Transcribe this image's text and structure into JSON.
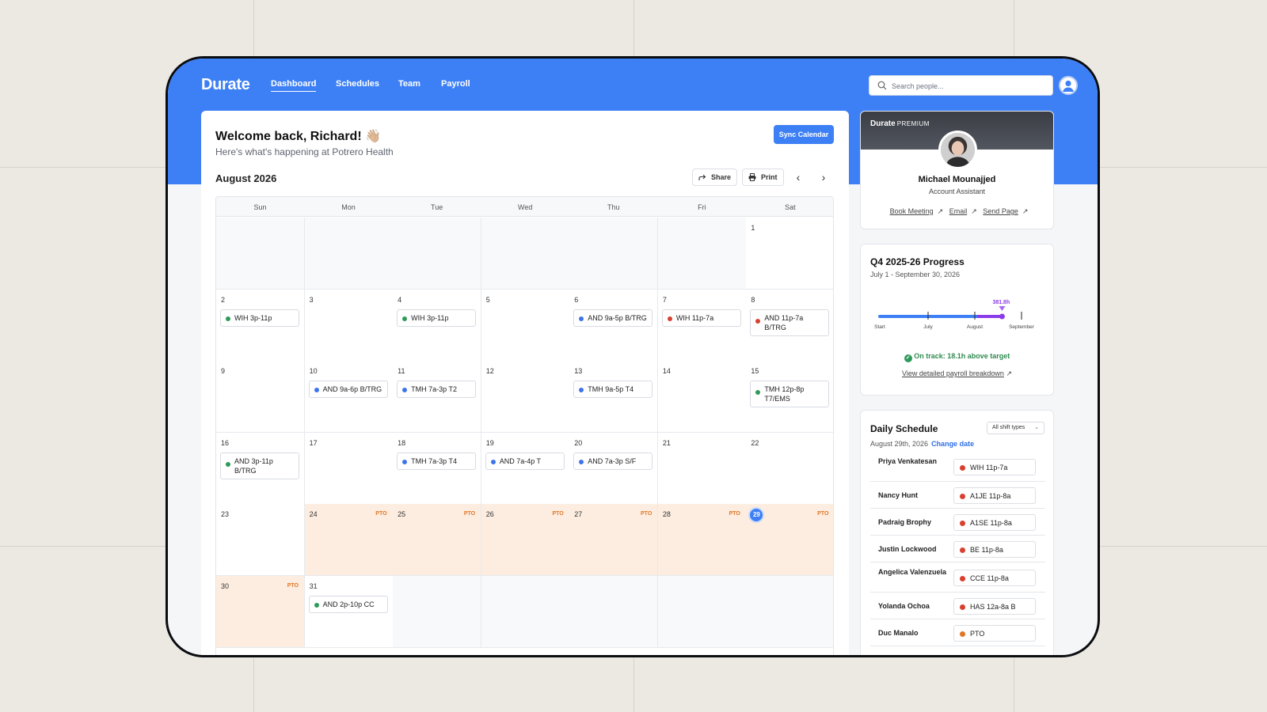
{
  "colors": {
    "accent": "#3d80f5",
    "green": "#2e9a5a",
    "blue": "#3d74ea",
    "red": "#d8402f",
    "orange": "#e07626",
    "pto_bg": "#fcede0",
    "purple": "#8a3ce8"
  },
  "app": {
    "logo": "Durate"
  },
  "nav": {
    "items": [
      {
        "label": "Dashboard",
        "active": true
      },
      {
        "label": "Schedules",
        "active": false
      },
      {
        "label": "Team",
        "active": false
      },
      {
        "label": "Payroll",
        "active": false
      }
    ]
  },
  "search": {
    "placeholder": "Search people...",
    "icon": "search-icon"
  },
  "header": {
    "welcome": "Welcome back, Richard! 👋🏼",
    "subtitle": "Here's what's happening at Potrero Health",
    "sync_label": "Sync Calendar"
  },
  "calendar": {
    "month": "August 2026",
    "share_label": "Share",
    "print_label": "Print",
    "days_of_week": [
      "Sun",
      "Mon",
      "Tue",
      "Wed",
      "Thu",
      "Fri",
      "Sat"
    ],
    "pto_label": "PTO",
    "today": 29,
    "first_weekday": 6,
    "days_in_month": 31,
    "pto_days": [
      24,
      25,
      26,
      27,
      28,
      29,
      30
    ],
    "shifts": {
      "2": {
        "text": "WIH 3p-11p",
        "color": "green"
      },
      "4": {
        "text": "WIH 3p-11p",
        "color": "green"
      },
      "6": {
        "text": "AND 9a-5p B/TRG",
        "color": "blue"
      },
      "7": {
        "text": "WIH 11p-7a",
        "color": "red"
      },
      "8": {
        "text": "AND 11p-7a B/TRG",
        "color": "red"
      },
      "10": {
        "text": "AND 9a-6p B/TRG",
        "color": "blue"
      },
      "11": {
        "text": "TMH 7a-3p T2",
        "color": "blue"
      },
      "13": {
        "text": "TMH 9a-5p T4",
        "color": "blue"
      },
      "15": {
        "text": "TMH 12p-8p T7/EMS",
        "color": "green"
      },
      "16": {
        "text": "AND 3p-11p B/TRG",
        "color": "green"
      },
      "18": {
        "text": "TMH 7a-3p T4",
        "color": "blue"
      },
      "19": {
        "text": "AND 7a-4p T",
        "color": "blue"
      },
      "20": {
        "text": "AND 7a-3p S/F",
        "color": "blue"
      },
      "31": {
        "text": "AND 2p-10p CC",
        "color": "green"
      }
    }
  },
  "premium": {
    "logo": "Durate",
    "badge": "PREMIUM",
    "name": "Michael Mounajjed",
    "role": "Account Assistant",
    "links": [
      "Book Meeting",
      "Email",
      "Send Page"
    ]
  },
  "progress": {
    "title": "Q4 2025-26 Progress",
    "range": "July 1 - September 30, 2026",
    "hours_label": "381.8h",
    "ticks": [
      "Start",
      "July",
      "August",
      "September"
    ],
    "fill_fraction": 0.78,
    "purple_start_fraction": 0.62,
    "ontrack": "On track: 18.1h above target",
    "details_link": "View detailed payroll breakdown"
  },
  "daily": {
    "title": "Daily Schedule",
    "filter": "All shift types",
    "date": "August 29th, 2026",
    "change_date": "Change date",
    "rows": [
      {
        "name": "Priya Venkatesan",
        "shift": "WIH 11p-7a",
        "color": "red"
      },
      {
        "name": "Nancy Hunt",
        "shift": "A1JE 11p-8a",
        "color": "red"
      },
      {
        "name": "Padraig Brophy",
        "shift": "A1SE 11p-8a",
        "color": "red"
      },
      {
        "name": "Justin Lockwood",
        "shift": "BE 11p-8a",
        "color": "red"
      },
      {
        "name": "Angelica Valenzuela",
        "shift": "CCE 11p-8a",
        "color": "red"
      },
      {
        "name": "Yolanda Ochoa",
        "shift": "HAS 12a-8a B",
        "color": "red"
      },
      {
        "name": "Duc Manalo",
        "shift": "PTO",
        "color": "orange"
      }
    ]
  }
}
